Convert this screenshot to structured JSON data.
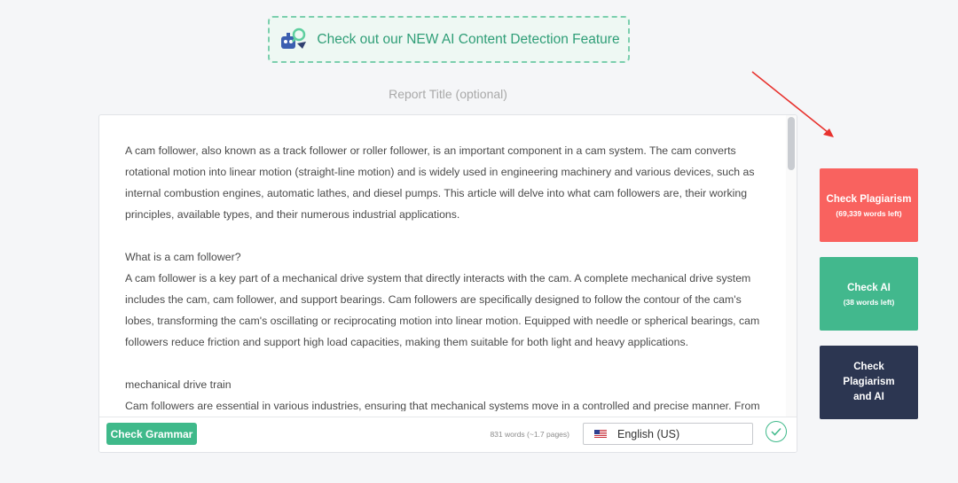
{
  "promo": {
    "text": "Check out our NEW AI Content Detection Feature",
    "icon": "robot-search-icon"
  },
  "report_title": {
    "placeholder": "Report Title (optional)",
    "value": ""
  },
  "editor": {
    "paragraphs": [
      "A cam follower, also known as a track follower or roller follower, is an important component in a cam system. The cam converts rotational motion into linear motion (straight-line motion) and is widely used in engineering machinery and various devices, such as internal combustion engines, automatic lathes, and diesel pumps. This article will delve into what cam followers are, their working principles, available types, and their numerous industrial applications.",
      "What is a cam follower?",
      "A cam follower is a key part of a mechanical drive system that directly interacts with the cam. A complete mechanical drive system includes the cam, cam follower, and support bearings. Cam followers are specifically designed to follow the contour of the cam's lobes, transforming the cam's oscillating or reciprocating motion into linear motion. Equipped with needle or spherical bearings, cam followers reduce friction and support high load capacities, making them suitable for both light and heavy applications.",
      "mechanical drive train",
      "Cam followers are essential in various industries, ensuring that mechanical systems move in a controlled and precise manner. From"
    ],
    "footer": {
      "grammar_button": "Check Grammar",
      "word_count": "831 words (~1.7 pages)",
      "language": "English (US)",
      "language_flag": "us-flag-icon",
      "status_icon": "check-circle-icon"
    }
  },
  "actions": {
    "plagiarism": {
      "title": "Check Plagiarism",
      "sub": "(69,339 words left)"
    },
    "ai": {
      "title": "Check AI",
      "sub": "(38 words left)"
    },
    "both": {
      "title": "Check Plagiarism and AI"
    }
  },
  "colors": {
    "plagiarism": "#f9625f",
    "ai": "#42b88d",
    "both": "#2c3651",
    "accent": "#3fb98a",
    "annotation_arrow": "#e8322e"
  }
}
